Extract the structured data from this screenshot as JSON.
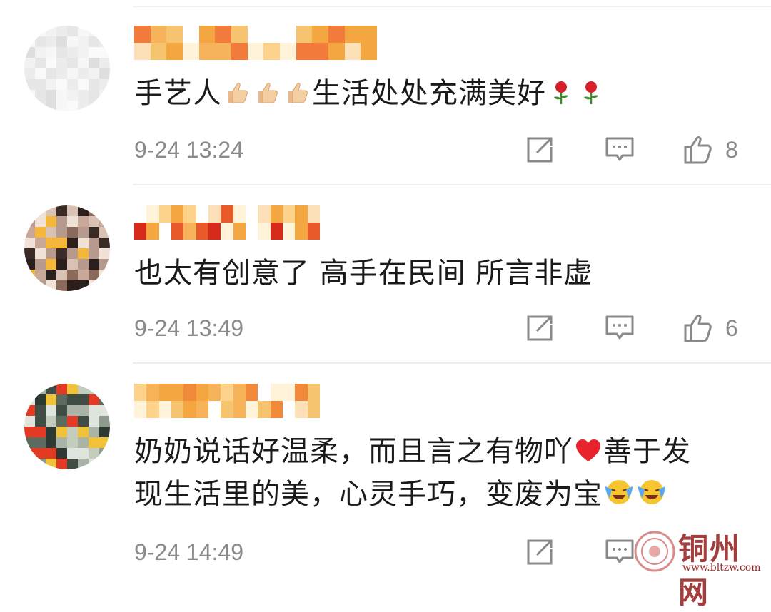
{
  "comments": [
    {
      "text": "手艺人",
      "text_after": "生活处处充满美好",
      "time": "9-24 13:24",
      "likes": "8"
    },
    {
      "text": "也太有创意了 高手在民间 所言非虚",
      "time": "9-24 13:49",
      "likes": "6"
    },
    {
      "text_line1": "奶奶说话好温柔，而且言之有物吖",
      "text_line1b": "善于发",
      "text_line2": "现生活里的美，心灵手巧，变废为宝",
      "time": "9-24 14:49"
    }
  ],
  "icons": {
    "repost": "repost-icon",
    "comment": "comment-icon",
    "like": "thumbs-up-icon",
    "thumbs_emoji": "thumbs-up-emoji",
    "rose_emoji": "rose-emoji",
    "heart_emoji": "heart-emoji",
    "crying_emoji": "crying-laughing-emoji"
  },
  "colors": {
    "text": "#1a1a1a",
    "meta": "#8a8a8a",
    "divider": "#eeeeee",
    "watermark": "#9a2a2a"
  },
  "watermark": {
    "name": "铜州网",
    "url": "www.bltzw.com"
  }
}
